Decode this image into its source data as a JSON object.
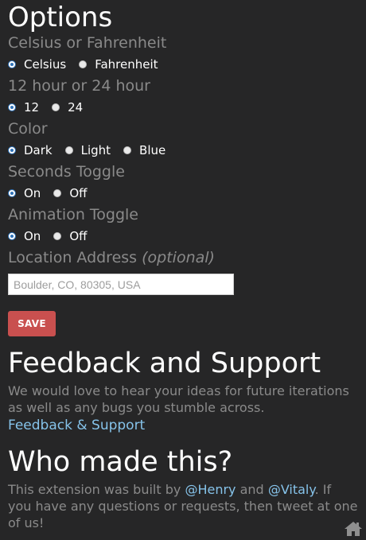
{
  "options": {
    "title": "Options",
    "temp": {
      "label": "Celsius or Fahrenheit",
      "opt1": "Celsius",
      "opt2": "Fahrenheit",
      "selected": "Celsius"
    },
    "hour": {
      "label": "12 hour or 24 hour",
      "opt1": "12",
      "opt2": "24",
      "selected": "12"
    },
    "color": {
      "label": "Color",
      "opt1": "Dark",
      "opt2": "Light",
      "opt3": "Blue",
      "selected": "Dark"
    },
    "seconds": {
      "label": "Seconds Toggle",
      "opt1": "On",
      "opt2": "Off",
      "selected": "On"
    },
    "animation": {
      "label": "Animation Toggle",
      "opt1": "On",
      "opt2": "Off",
      "selected": "On"
    },
    "location": {
      "label": "Location Address",
      "optional": "(optional)",
      "placeholder": "Boulder, CO, 80305, USA",
      "value": ""
    },
    "save_label": "SAVE"
  },
  "feedback": {
    "title": "Feedback and Support",
    "text": "We would love to hear your ideas for future iterations as well as any bugs you stumble across.",
    "link": "Feedback & Support"
  },
  "credits": {
    "title": "Who made this?",
    "text_before": "This extension was built by",
    "author1": "@Henry",
    "and": "and",
    "author2": "@Vitaly",
    "text_after": ". If you have any questions or requests, then tweet at one of us!"
  },
  "icons": {
    "home": "home-icon"
  },
  "colors": {
    "background": "#262627",
    "muted_text": "#8a8a8a",
    "link": "#86c3ea",
    "save_button": "#c9504f",
    "radio_accent": "#2f73b9"
  }
}
